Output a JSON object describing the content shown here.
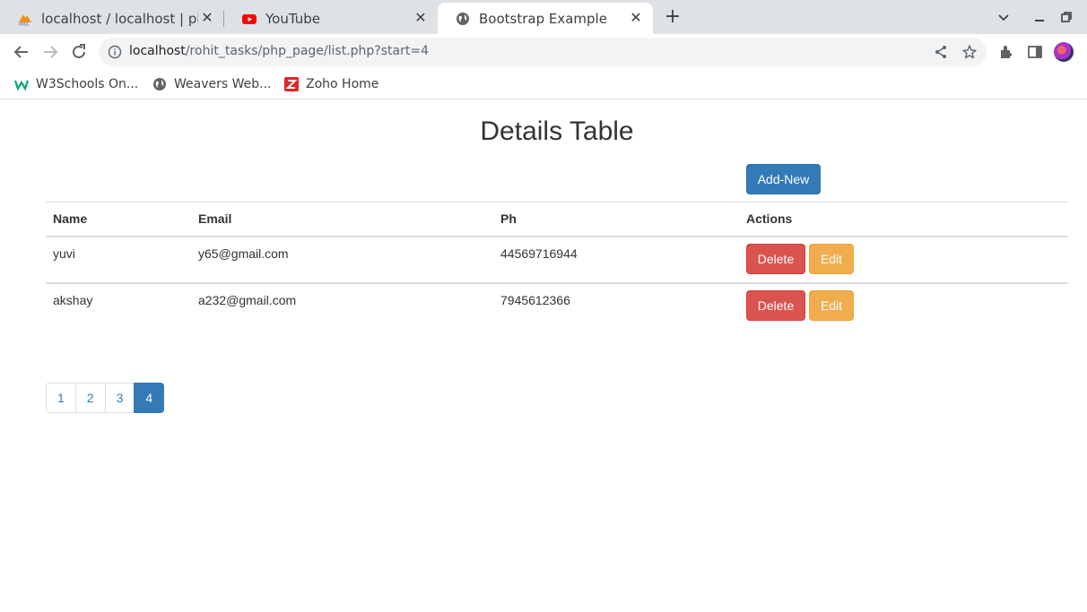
{
  "browser": {
    "tabs": [
      {
        "title": "localhost / localhost | php",
        "favicon": "phpmyadmin-icon"
      },
      {
        "title": "YouTube",
        "favicon": "youtube-icon"
      },
      {
        "title": "Bootstrap Example",
        "favicon": "globe-icon"
      }
    ],
    "url_host": "localhost",
    "url_path": "/rohit_tasks/php_page/list.php?start=4",
    "bookmarks": [
      {
        "label": "W3Schools On...",
        "icon": "w3schools-icon"
      },
      {
        "label": "Weavers Web...",
        "icon": "globe-icon"
      },
      {
        "label": "Zoho Home",
        "icon": "zoho-icon"
      }
    ]
  },
  "page": {
    "title": "Details Table",
    "add_new_label": "Add-New",
    "table": {
      "headers": [
        "Name",
        "Email",
        "Ph",
        "Actions"
      ],
      "rows": [
        {
          "name": "yuvi",
          "email": "y65@gmail.com",
          "ph": "44569716944",
          "delete": "Delete",
          "edit": "Edit"
        },
        {
          "name": "akshay",
          "email": "a232@gmail.com",
          "ph": "7945612366",
          "delete": "Delete",
          "edit": "Edit"
        }
      ]
    },
    "pagination": {
      "pages": [
        "1",
        "2",
        "3",
        "4"
      ],
      "active": "4"
    }
  },
  "colors": {
    "primary": "#337ab7",
    "danger": "#d9534f",
    "warning": "#f0ad4e",
    "chrome_tabstrip": "#dee1e6"
  }
}
